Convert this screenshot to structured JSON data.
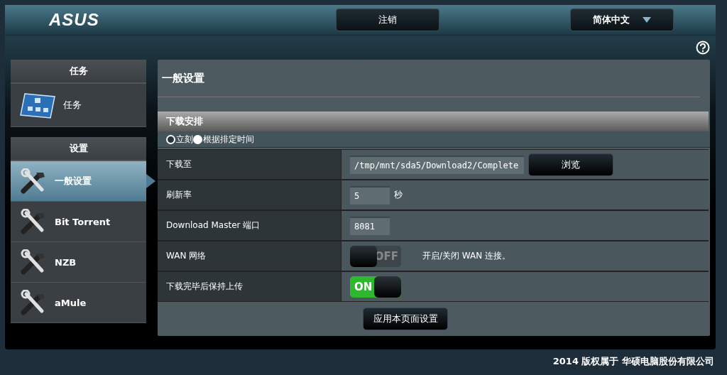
{
  "header": {
    "logo": "ASUS",
    "logout_button": "注销",
    "language": "简体中文"
  },
  "sidebar": [
    {
      "title": "任务",
      "items": [
        {
          "label": "任务",
          "selected": false
        }
      ]
    },
    {
      "title": "设置",
      "items": [
        {
          "label": "一般设置",
          "selected": true
        },
        {
          "label": "Bit Torrent",
          "selected": false
        },
        {
          "label": "NZB",
          "selected": false
        },
        {
          "label": "aMule",
          "selected": false
        }
      ]
    }
  ],
  "page_title": "一般设置",
  "section": {
    "title": "下载安排",
    "options": [
      {
        "label": "立刻",
        "selected": false
      },
      {
        "label": "根据排定时间",
        "selected": true
      }
    ]
  },
  "rows": [
    {
      "kind": "field",
      "label": "下载至",
      "value": "/tmp/mnt/sda5/Download2/Complete",
      "button": "浏览"
    },
    {
      "kind": "field",
      "label": "刷新率",
      "value": "5",
      "unit": "秒"
    },
    {
      "kind": "field",
      "label": "Download Master 端口",
      "value": "8081"
    },
    {
      "kind": "toggle",
      "label": "WAN 网络",
      "on": false,
      "switch_text": "OFF",
      "note": "开启/关闭 WAN 连接。"
    },
    {
      "kind": "toggle",
      "label": "下载完毕后保持上传",
      "on": true,
      "switch_text": "ON"
    }
  ],
  "apply_button": "应用本页面设置",
  "footer": "2014 版权属于 华硕电脑股份有限公司"
}
